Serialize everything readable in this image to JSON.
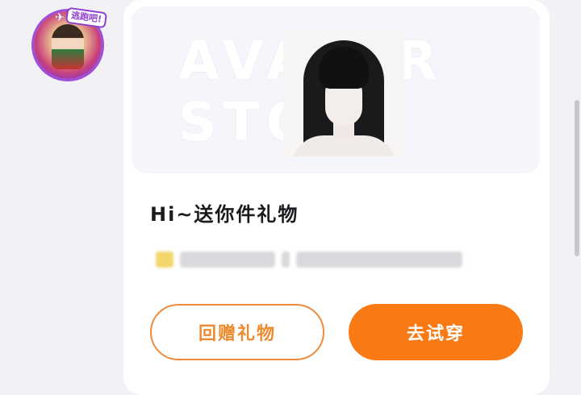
{
  "avatar": {
    "badge_text": "逃跑吧!",
    "icon": "character-avatar-icon"
  },
  "hero": {
    "watermark": "AVATAR\nSTORE",
    "image": "black-long-hair-avatar-preview"
  },
  "gift": {
    "title": "Hi~送你件礼物"
  },
  "buttons": {
    "return_gift": "回赠礼物",
    "try_on": "去试穿"
  },
  "colors": {
    "accent": "#f97a14",
    "outline": "#f08a3a",
    "avatar_ring": "#9d4edd"
  }
}
